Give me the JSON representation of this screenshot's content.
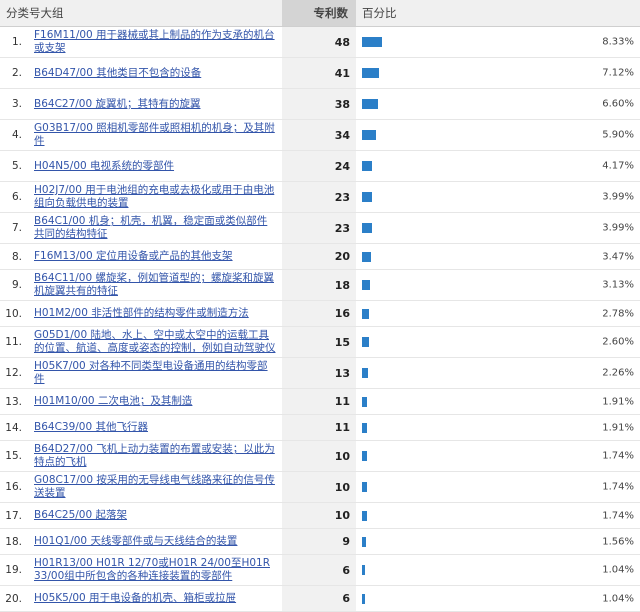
{
  "header": {
    "col_category": "分类号大组",
    "col_count": "专利数",
    "col_percent": "百分比"
  },
  "accent_color": "#2b7fc8",
  "rows": [
    {
      "idx": "1.",
      "label": "F16M11/00 用于器械或其上制品的作为支承的机台或支架",
      "count": "48",
      "percent": "8.33%",
      "value": 8.33,
      "tall": true
    },
    {
      "idx": "2.",
      "label": "B64D47/00 其他类目不包含的设备",
      "count": "41",
      "percent": "7.12%",
      "value": 7.12,
      "tall": true
    },
    {
      "idx": "3.",
      "label": "B64C27/00 旋翼机；其特有的旋翼",
      "count": "38",
      "percent": "6.60%",
      "value": 6.6,
      "tall": true
    },
    {
      "idx": "4.",
      "label": "G03B17/00 照相机零部件或照相机的机身；及其附件",
      "count": "34",
      "percent": "5.90%",
      "value": 5.9,
      "tall": true
    },
    {
      "idx": "5.",
      "label": "H04N5/00 电视系统的零部件",
      "count": "24",
      "percent": "4.17%",
      "value": 4.17,
      "tall": true
    },
    {
      "idx": "6.",
      "label": "H02J7/00 用于电池组的充电或去极化或用于由电池组向负载供电的装置",
      "count": "23",
      "percent": "3.99%",
      "value": 3.99,
      "tall": true
    },
    {
      "idx": "7.",
      "label": "B64C1/00 机身；机壳，机翼，稳定面或类似部件共同的结构特征",
      "count": "23",
      "percent": "3.99%",
      "value": 3.99,
      "tall": true
    },
    {
      "idx": "8.",
      "label": "F16M13/00 定位用设备或产品的其他支架",
      "count": "20",
      "percent": "3.47%",
      "value": 3.47,
      "tall": false
    },
    {
      "idx": "9.",
      "label": "B64C11/00 螺旋桨，例如管道型的；螺旋桨和旋翼机旋翼共有的特征",
      "count": "18",
      "percent": "3.13%",
      "value": 3.13,
      "tall": true
    },
    {
      "idx": "10.",
      "label": "H01M2/00 非活性部件的结构零件或制造方法",
      "count": "16",
      "percent": "2.78%",
      "value": 2.78,
      "tall": false
    },
    {
      "idx": "11.",
      "label": "G05D1/00 陆地、水上、空中或太空中的运载工具的位置、航道、高度或姿态的控制，例如自动驾驶仪",
      "count": "15",
      "percent": "2.60%",
      "value": 2.6,
      "tall": true
    },
    {
      "idx": "12.",
      "label": "H05K7/00 对各种不同类型电设备通用的结构零部件",
      "count": "13",
      "percent": "2.26%",
      "value": 2.26,
      "tall": false
    },
    {
      "idx": "13.",
      "label": "H01M10/00 二次电池；及其制造",
      "count": "11",
      "percent": "1.91%",
      "value": 1.91,
      "tall": false
    },
    {
      "idx": "14.",
      "label": "B64C39/00 其他飞行器",
      "count": "11",
      "percent": "1.91%",
      "value": 1.91,
      "tall": false
    },
    {
      "idx": "15.",
      "label": "B64D27/00 飞机上动力装置的布置或安装；以此为特点的飞机",
      "count": "10",
      "percent": "1.74%",
      "value": 1.74,
      "tall": true
    },
    {
      "idx": "16.",
      "label": "G08C17/00 按采用的无导线电气线路来征的信号传送装置",
      "count": "10",
      "percent": "1.74%",
      "value": 1.74,
      "tall": true
    },
    {
      "idx": "17.",
      "label": "B64C25/00 起落架",
      "count": "10",
      "percent": "1.74%",
      "value": 1.74,
      "tall": false
    },
    {
      "idx": "18.",
      "label": "H01Q1/00 天线零部件或与天线结合的装置",
      "count": "9",
      "percent": "1.56%",
      "value": 1.56,
      "tall": false
    },
    {
      "idx": "19.",
      "label": "H01R13/00 H01R 12/70或H01R 24/00至H01R 33/00组中所包含的各种连接装置的零部件",
      "count": "6",
      "percent": "1.04%",
      "value": 1.04,
      "tall": true
    },
    {
      "idx": "20.",
      "label": "H05K5/00 用于电设备的机壳、箱柜或拉屉",
      "count": "6",
      "percent": "1.04%",
      "value": 1.04,
      "tall": false
    }
  ]
}
